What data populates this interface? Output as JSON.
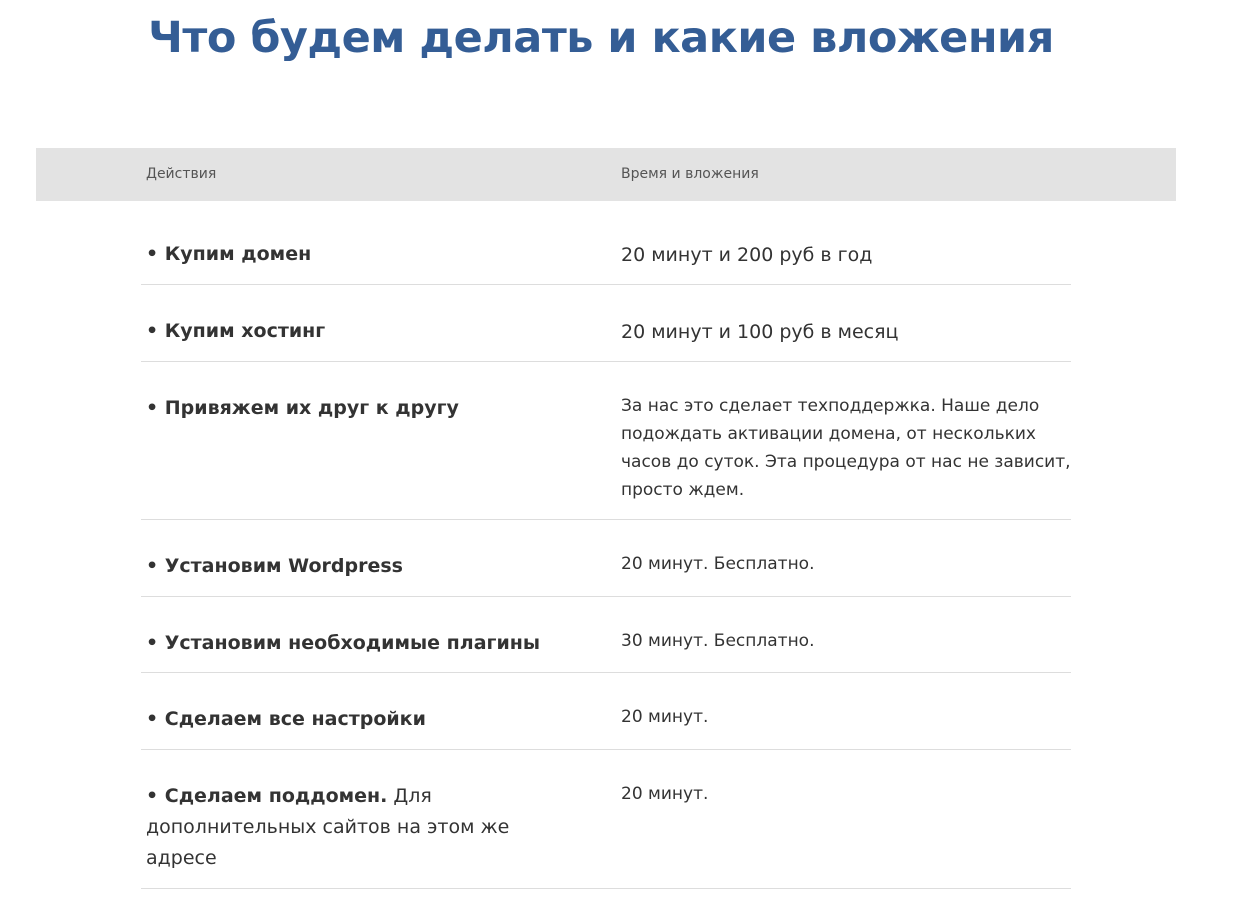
{
  "title": "Что будем делать и какие вложения",
  "table": {
    "headers": {
      "actions": "Действия",
      "time": "Время и вложения"
    },
    "rows": [
      {
        "action": "• Купим домен",
        "action_rest": "",
        "time": "20 минут и 200 руб в год"
      },
      {
        "action": "• Купим хостинг",
        "action_rest": "",
        "time": "20 минут и 100 руб в месяц"
      },
      {
        "action": "• Привяжем их друг к другу",
        "action_rest": "",
        "time": "За нас это сделает техподдержка. Наше дело подождать активации домена, от нескольких часов до суток. Эта процедура от нас не зависит, просто ждем."
      },
      {
        "action": "• Установим Wordpress",
        "action_rest": "",
        "time": "20 минут. Бесплатно."
      },
      {
        "action": "• Установим необходимые плагины",
        "action_rest": "",
        "time": "30 минут. Бесплатно."
      },
      {
        "action": "• Сделаем все настройки",
        "action_rest": "",
        "time": "20 минут."
      },
      {
        "action": "• Сделаем поддомен.",
        "action_rest": " Для дополнительных сайтов на этом же адресе",
        "time": "20 минут."
      }
    ]
  }
}
